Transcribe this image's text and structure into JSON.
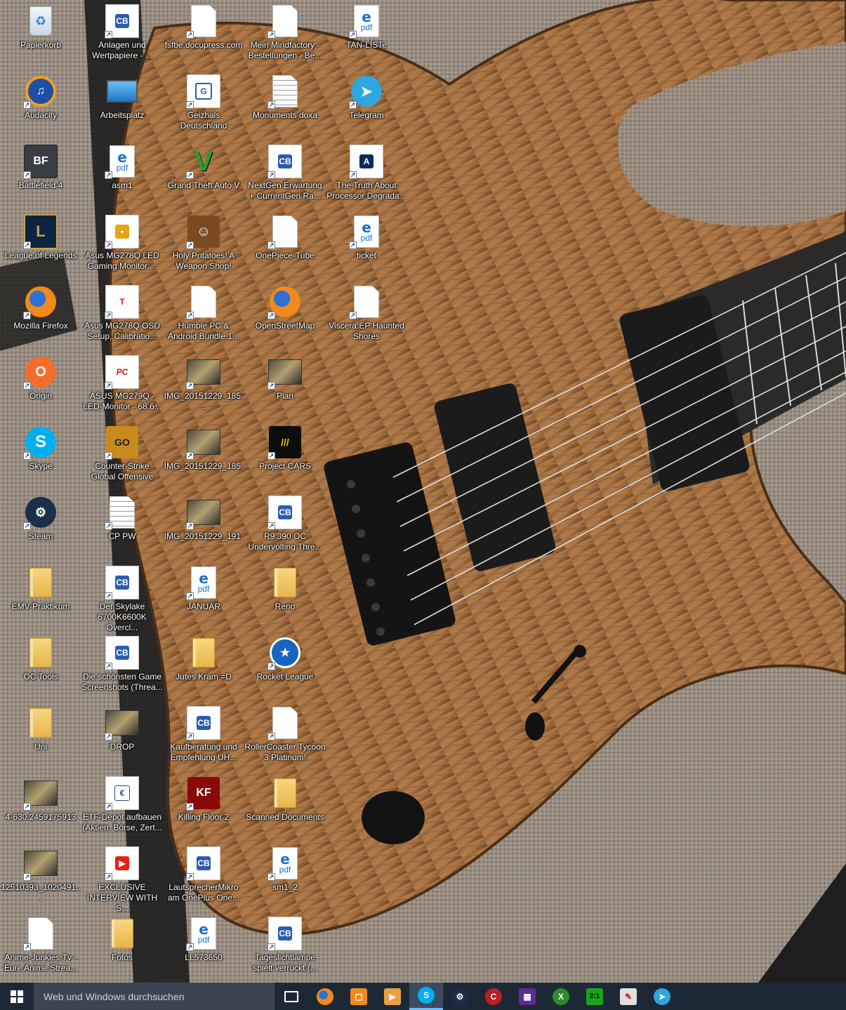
{
  "desktop": {
    "icons": [
      {
        "label": "Papierkorb",
        "icon": "recycle-bin-icon"
      },
      {
        "label": "Audacity",
        "icon": "audacity-icon"
      },
      {
        "label": "Battlefield 4",
        "icon": "battlefield-icon"
      },
      {
        "label": "League of Legends",
        "icon": "league-of-legends-icon"
      },
      {
        "label": "Mozilla Firefox",
        "icon": "firefox-icon"
      },
      {
        "label": "Origin",
        "icon": "origin-icon"
      },
      {
        "label": "Skype",
        "icon": "skype-icon"
      },
      {
        "label": "Steam",
        "icon": "steam-icon"
      },
      {
        "label": "EMV-Praktikum",
        "icon": "folder-icon"
      },
      {
        "label": "OC Tools",
        "icon": "folder-icon"
      },
      {
        "label": "Uni",
        "icon": "folder-icon"
      },
      {
        "label": "4-630.2459175913",
        "icon": "image-file-icon"
      },
      {
        "label": "12510393_1020491...",
        "icon": "image-file-icon"
      },
      {
        "label": "Anime-Junkies.Tv -\nEure Anime Strea...",
        "icon": "web-shortcut-icon"
      },
      {
        "label": "Anlagen und\nWertpapiere - ...",
        "icon": "computerbase-icon"
      },
      {
        "label": "Arbeitsplatz",
        "icon": "this-pc-icon"
      },
      {
        "label": "asm1",
        "icon": "pdf-icon"
      },
      {
        "label": "Asus MG278Q LED\nGaming Monitor ...",
        "icon": "shop-icon"
      },
      {
        "label": "Asus MG278Q OSD\nSetup, Calibratio...",
        "icon": "tftcentral-icon"
      },
      {
        "label": "ASUS MG279Q -\nLED-Monitor - 68.6...",
        "icon": "pcgames-icon"
      },
      {
        "label": "Counter-Strike\nGlobal Offensive",
        "icon": "csgo-icon"
      },
      {
        "label": "CP PW",
        "icon": "text-document-icon"
      },
      {
        "label": "Der Skylake\n6700K6600K Overcl...",
        "icon": "computerbase-icon"
      },
      {
        "label": "Die schönsten Game\nScreenshots (Threa...",
        "icon": "computerbase-icon"
      },
      {
        "label": "DROP",
        "icon": "image-file-icon"
      },
      {
        "label": "ETF-Depot aufbauen\n(Aktien, Börse, Zert...",
        "icon": "euro-icon"
      },
      {
        "label": "EXCLUSIVE\nINTERVIEW WITH S...",
        "icon": "youtube-icon"
      },
      {
        "label": "Fotos",
        "icon": "folder-icon"
      },
      {
        "label": "fsfbe.docupress.com",
        "icon": "web-shortcut-icon"
      },
      {
        "label": "Geizhals Deutschland",
        "icon": "geizhals-icon"
      },
      {
        "label": "Grand Theft Auto V",
        "icon": "gta-v-icon"
      },
      {
        "label": "Holy Potatoes! A\nWeapon Shop!",
        "icon": "holy-potatoes-icon"
      },
      {
        "label": "Humble PC &\nAndroid Bundle 1...",
        "icon": "web-shortcut-icon"
      },
      {
        "label": "IMG_20151229_185...",
        "icon": "image-file-icon"
      },
      {
        "label": "IMG_20151229_185...",
        "icon": "image-file-icon"
      },
      {
        "label": "IMG_20151229_191...",
        "icon": "image-file-icon"
      },
      {
        "label": "JANUAR",
        "icon": "pdf-icon"
      },
      {
        "label": "Jutes Kram =D",
        "icon": "folder-icon"
      },
      {
        "label": "Kaufberatung und\nEmpfehlung UH...",
        "icon": "computerbase-icon"
      },
      {
        "label": "Killing Floor 2",
        "icon": "killing-floor-icon"
      },
      {
        "label": "LautsprecherMikro\nam OnePlus One...",
        "icon": "computerbase-icon"
      },
      {
        "label": "LL573650",
        "icon": "pdf-icon"
      },
      {
        "label": "Mein Mindfactory -\nBestellungen - Be...",
        "icon": "web-shortcut-icon"
      },
      {
        "label": "Monuments doxa",
        "icon": "text-document-icon"
      },
      {
        "label": "NextGen Erwartung\n+ CurrentGen Ra...",
        "icon": "computerbase-icon"
      },
      {
        "label": "OnePiece-Tube",
        "icon": "web-shortcut-icon"
      },
      {
        "label": "OpenStreetMap",
        "icon": "firefox-icon"
      },
      {
        "label": "Plan",
        "icon": "image-file-icon"
      },
      {
        "label": "Project CARS",
        "icon": "project-cars-icon"
      },
      {
        "label": "R9 390 OC\nUndervolting Thre...",
        "icon": "computerbase-icon"
      },
      {
        "label": "Reno",
        "icon": "folder-icon"
      },
      {
        "label": "Rocket League",
        "icon": "rocket-league-icon"
      },
      {
        "label": "RollerCoaster Tycoon\n3 Platinum!",
        "icon": "web-shortcut-icon"
      },
      {
        "label": "Scanned Documents",
        "icon": "folder-icon"
      },
      {
        "label": "sm1_2",
        "icon": "pdf-icon"
      },
      {
        "label": "Tageslichtlampe\nspielt verrückt (...",
        "icon": "computerbase-icon"
      },
      {
        "label": "TAN-LISTe",
        "icon": "pdf-icon"
      },
      {
        "label": "Telegram",
        "icon": "telegram-icon"
      },
      {
        "label": "The Truth About\nProcessor Degrada...",
        "icon": "anandtech-icon"
      },
      {
        "label": "ticket",
        "icon": "pdf-icon"
      },
      {
        "label": "Viscera EP Haunted\nShores",
        "icon": "web-shortcut-icon"
      }
    ]
  },
  "taskbar": {
    "start_icon": "windows-start-icon",
    "search_placeholder": "Web und Windows durchsuchen",
    "apps": [
      {
        "name": "task-view",
        "icon": "task-view-icon",
        "active": false
      },
      {
        "name": "firefox",
        "icon": "firefox-icon",
        "active": false
      },
      {
        "name": "store-app",
        "icon": "store-icon",
        "active": false
      },
      {
        "name": "media-player",
        "icon": "media-player-icon",
        "active": false
      },
      {
        "name": "skype",
        "icon": "skype-icon",
        "active": true
      },
      {
        "name": "steam",
        "icon": "steam-icon",
        "active": false
      },
      {
        "name": "cleaner-tool",
        "icon": "cleaner-icon",
        "active": false
      },
      {
        "name": "cpu-tool",
        "icon": "cpu-icon",
        "active": false
      },
      {
        "name": "xbox",
        "icon": "xbox-icon",
        "active": false
      },
      {
        "name": "dual-monitor-tool",
        "icon": "dual-monitor-icon",
        "active": false
      },
      {
        "name": "notes-tool",
        "icon": "notes-icon",
        "active": false
      },
      {
        "name": "telegram",
        "icon": "telegram-icon",
        "active": false
      }
    ]
  },
  "colors": {
    "taskbar_bg": "#1d2836",
    "search_bg": "#3b4453",
    "active_indicator": "#76b9ed",
    "label_text": "#ffffff"
  }
}
